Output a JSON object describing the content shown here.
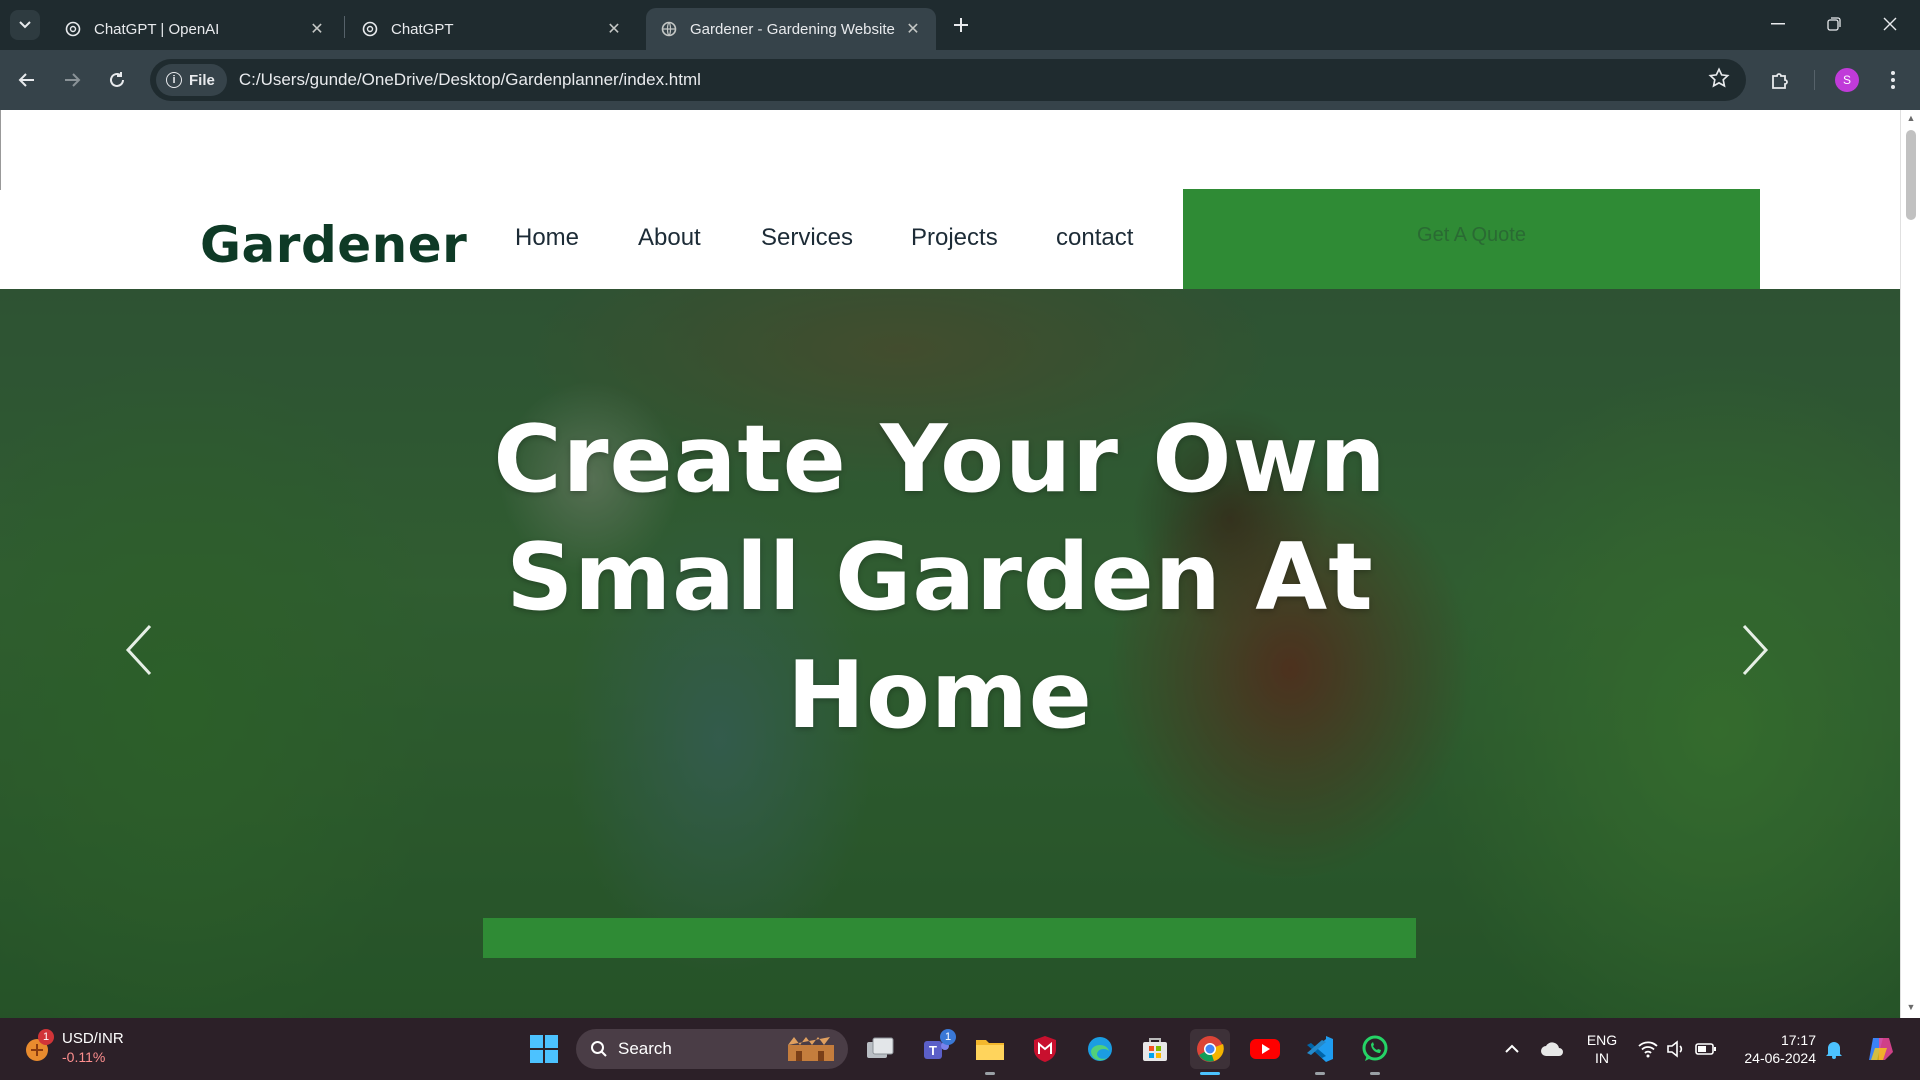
{
  "browser": {
    "tabs": [
      {
        "title": "ChatGPT | OpenAI",
        "active": false
      },
      {
        "title": "ChatGPT",
        "active": false
      },
      {
        "title": "Gardener - Gardening Website",
        "active": true
      }
    ],
    "chip_label": "File",
    "url": "C:/Users/gunde/OneDrive/Desktop/Gardenplanner/index.html",
    "profile_initial": "S"
  },
  "site": {
    "logo": "Gardener",
    "menu": [
      "Home",
      "About",
      "Services",
      "Projects",
      "contact"
    ],
    "quote_button": "Get A Quote",
    "hero": {
      "line1": "Create Your Own",
      "line2": "Small Garden At",
      "line3": "Home"
    }
  },
  "taskbar": {
    "widget_title": "USD/INR",
    "widget_value": "-0.11%",
    "widget_badge": "1",
    "search_label": "Search",
    "teams_badge": "1",
    "lang_top": "ENG",
    "lang_bottom": "IN",
    "time": "17:17",
    "date": "24-06-2024"
  },
  "colors": {
    "brand_green": "#2f8b35",
    "logo_green": "#0e3a26"
  }
}
